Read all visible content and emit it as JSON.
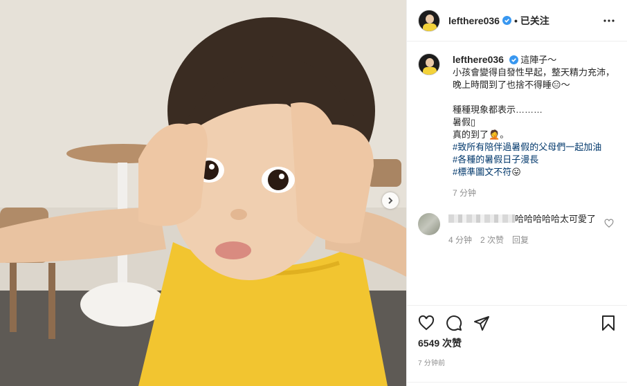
{
  "post": {
    "username": "lefthere036",
    "follow_status": "• 已关注",
    "caption_intro": "這陣子～",
    "caption_line1": "小孩會變得自發性早起，整天精力充沛，晚上時間到了也捨不得睡",
    "caption_line1_emoji": "😑",
    "caption_line1_end": "～",
    "caption_line2": "種種現象都表示………",
    "caption_line3": "暑假▯",
    "caption_line4": "真的到了",
    "caption_line4_emoji": "🤦",
    "caption_line4_end": "。",
    "hashtags": [
      "#致所有陪伴過暑假的父母們一起加油",
      "#各種的暑假日子漫長",
      "#標準圖文不符"
    ],
    "hashtag_emoji": "😛",
    "caption_time": "7 分钟"
  },
  "comment": {
    "text": "哈哈哈哈哈太可愛了",
    "time": "4 分钟",
    "likes": "2 次赞",
    "reply": "回复"
  },
  "footer": {
    "likes": "6549 次赞",
    "time": "7 分钟前"
  },
  "icons": {
    "verified": "verified-badge-icon",
    "more": "more-options-icon",
    "like": "heart-icon",
    "comment": "comment-bubble-icon",
    "share": "paper-plane-icon",
    "save": "bookmark-icon",
    "next": "chevron-right-icon"
  },
  "colors": {
    "verified_blue": "#3897f0",
    "hashtag": "#00376b",
    "dress_yellow": "#f2c530"
  }
}
